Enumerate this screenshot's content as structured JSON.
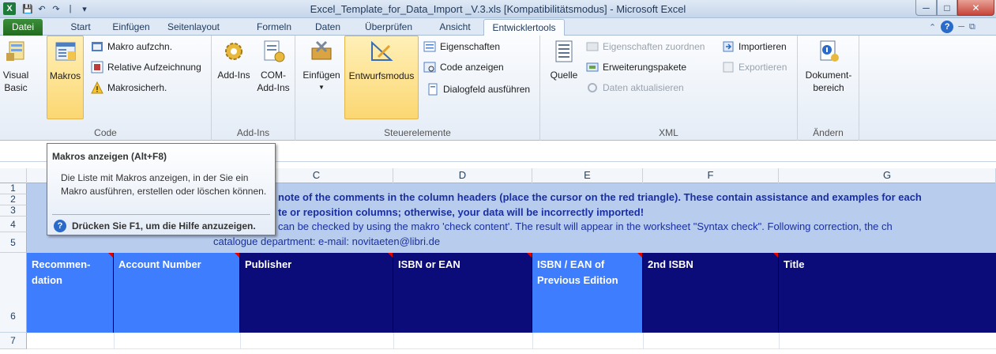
{
  "window": {
    "title": "Excel_Template_for_Data_Import _V.3.xls  [Kompatibilitätsmodus]  -  Microsoft Excel",
    "qat_separator": "|"
  },
  "tabs": [
    "Datei",
    "Start",
    "Einfügen",
    "Seitenlayout",
    "Formeln",
    "Daten",
    "Überprüfen",
    "Ansicht",
    "Entwicklertools"
  ],
  "active_tab": "Entwicklertools",
  "ribbon": {
    "code": {
      "label": "Code",
      "visual_basic_1": "Visual",
      "visual_basic_2": "Basic",
      "makros": "Makros",
      "makro_aufz": "Makro aufzchn.",
      "relative": "Relative Aufzeichnung",
      "makrosicher": "Makrosicherh."
    },
    "addins": {
      "label": "Add-Ins",
      "addins": "Add-Ins",
      "com_1": "COM-",
      "com_2": "Add-Ins"
    },
    "steuerelemente": {
      "label": "Steuerelemente",
      "einfuegen": "Einfügen",
      "entwurfsmodus": "Entwurfsmodus",
      "eigenschaften": "Eigenschaften",
      "code_anzeigen": "Code anzeigen",
      "dialogfeld": "Dialogfeld ausführen"
    },
    "xml": {
      "label": "XML",
      "quelle": "Quelle",
      "eig_zuordnen": "Eigenschaften zuordnen",
      "erweiterung": "Erweiterungspakete",
      "daten_akt": "Daten aktualisieren",
      "importieren": "Importieren",
      "exportieren": "Exportieren"
    },
    "aendern": {
      "label": "Ändern",
      "dok_1": "Dokument-",
      "dok_2": "bereich"
    }
  },
  "columns": [
    "C",
    "D",
    "E",
    "F",
    "G"
  ],
  "rows": [
    "1",
    "2",
    "3",
    "4",
    "5",
    "6",
    "7"
  ],
  "info_band": {
    "line1": "note of the comments in the column headers (place the cursor on the red triangle). These contain assistance and examples for each",
    "line2": "te or reposition columns; otherwise, your data will be incorrectly imported!",
    "line3": "can be checked by using the makro 'check content'. The result will appear in the worksheet \"Syntax check\". Following correction, the ch",
    "line4": "catalogue department: e-mail: novitaeten@libri.de"
  },
  "headers": {
    "recommendation": "Recommen-dation",
    "account": "Account Number",
    "publisher": "Publisher",
    "isbn": "ISBN or EAN",
    "isbn_prev": "ISBN / EAN of Previous Edition",
    "isbn2": "2nd ISBN",
    "title": "Title"
  },
  "tooltip": {
    "title": "Makros anzeigen (Alt+F8)",
    "body": "Die Liste mit Makros anzeigen, in der Sie ein Makro ausführen, erstellen oder löschen können.",
    "help": "Drücken Sie F1, um die Hilfe anzuzeigen."
  },
  "colors": {
    "header_dark": "#0b0b7a",
    "header_light": "#3f7dff",
    "info_bg": "#b8ccee",
    "info_text": "#1a2fa0"
  }
}
